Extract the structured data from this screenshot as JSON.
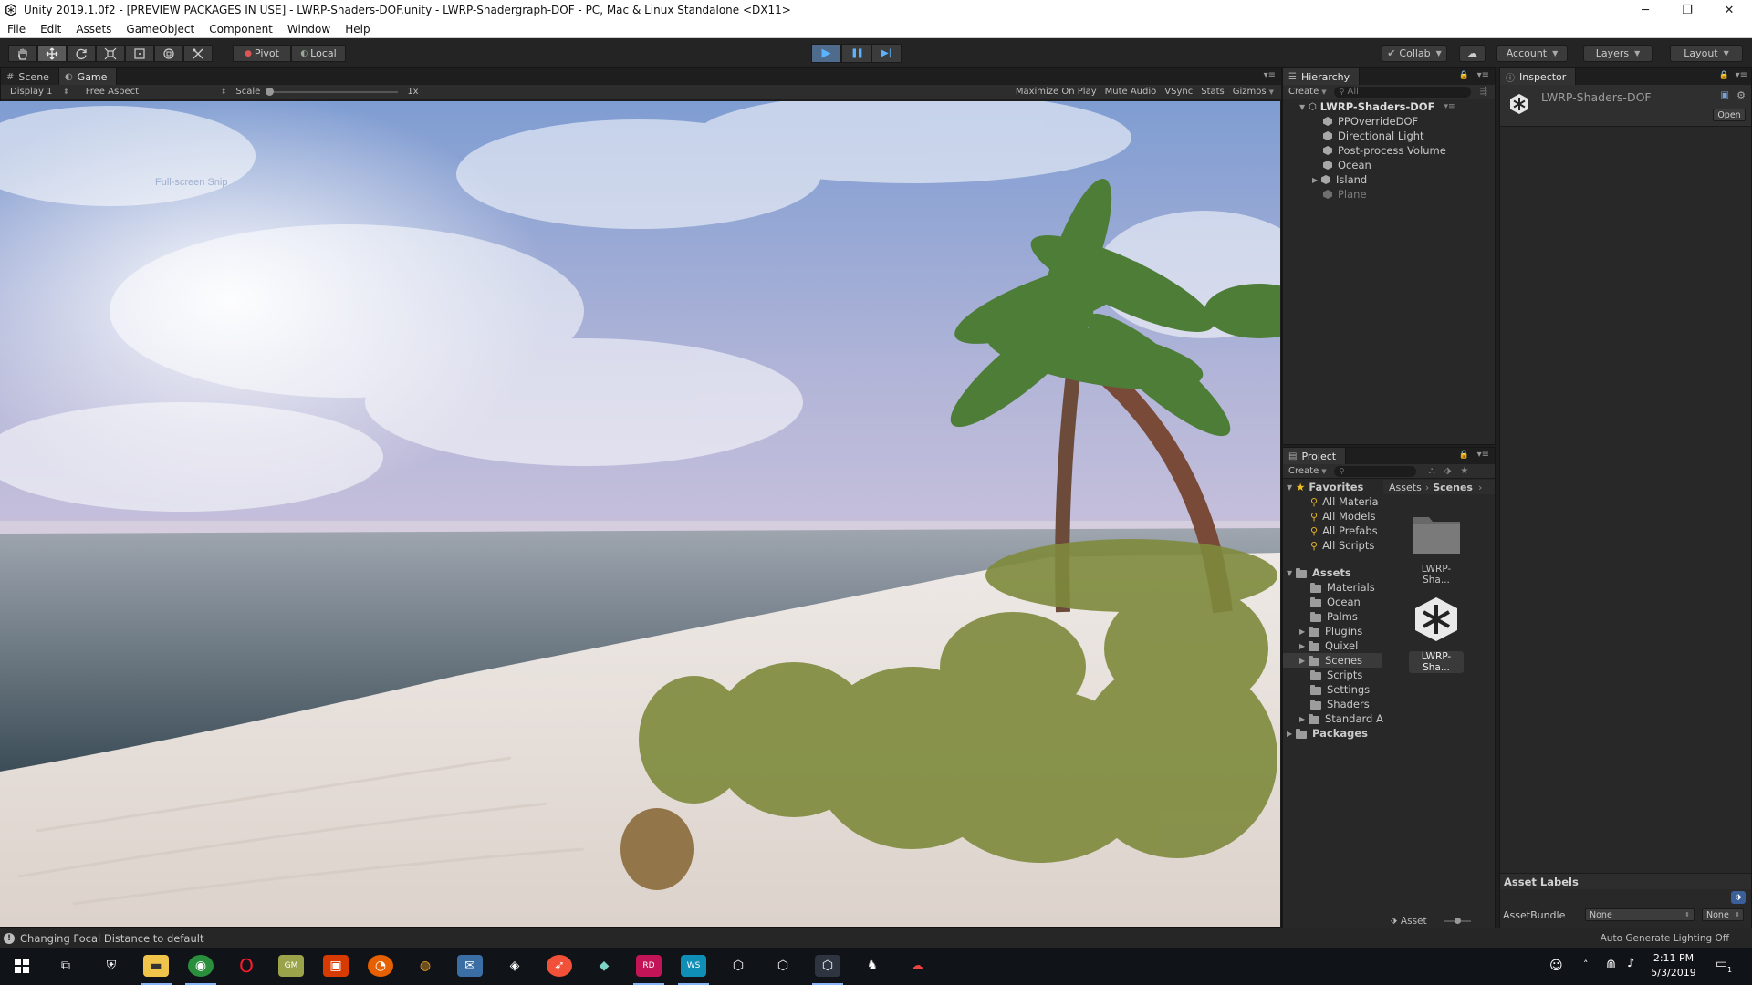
{
  "window": {
    "title": "Unity 2019.1.0f2 - [PREVIEW PACKAGES IN USE] - LWRP-Shaders-DOF.unity - LWRP-Shadergraph-DOF - PC, Mac & Linux Standalone <DX11>",
    "minimize_glyph": "─",
    "maximize_glyph": "❐",
    "close_glyph": "✕"
  },
  "menu": [
    "File",
    "Edit",
    "Assets",
    "GameObject",
    "Component",
    "Window",
    "Help"
  ],
  "toolbar": {
    "tools": [
      "hand-icon",
      "move-icon",
      "rotate-icon",
      "scale-icon",
      "rect-icon",
      "transform-icon",
      "custom-tool-icon"
    ],
    "pivot_label": "Pivot",
    "local_label": "Local",
    "play_glyph": "▶",
    "pause_glyph": "❚❚",
    "step_glyph": "▶|",
    "collab_label": "Collab",
    "account_label": "Account",
    "layers_label": "Layers",
    "layout_label": "Layout"
  },
  "scene_panel": {
    "tabs": [
      {
        "label": "Scene",
        "icon": "#"
      },
      {
        "label": "Game",
        "icon": "◐"
      }
    ],
    "display_label": "Display 1",
    "aspect_label": "Free Aspect",
    "scale_label": "Scale",
    "scale_value": "1x",
    "options": [
      "Maximize On Play",
      "Mute Audio",
      "VSync",
      "Stats",
      "Gizmos"
    ],
    "overlay_text": "Full-screen Snip"
  },
  "hierarchy": {
    "tab_label": "Hierarchy",
    "create_label": "Create",
    "search_placeholder": "All",
    "scene_name": "LWRP-Shaders-DOF",
    "items": [
      {
        "label": "PPOverrideDOF",
        "expandable": false,
        "dim": false
      },
      {
        "label": "Directional Light",
        "expandable": false,
        "dim": false
      },
      {
        "label": "Post-process Volume",
        "expandable": false,
        "dim": false
      },
      {
        "label": "Ocean",
        "expandable": false,
        "dim": false
      },
      {
        "label": "Island",
        "expandable": true,
        "dim": false
      },
      {
        "label": "Plane",
        "expandable": false,
        "dim": true
      }
    ]
  },
  "project": {
    "tab_label": "Project",
    "create_label": "Create",
    "favorites_label": "Favorites",
    "favorites": [
      "All Materia",
      "All Models",
      "All Prefabs",
      "All Scripts"
    ],
    "assets_label": "Assets",
    "asset_folders": [
      {
        "label": "Materials",
        "expandable": false
      },
      {
        "label": "Ocean",
        "expandable": false
      },
      {
        "label": "Palms",
        "expandable": false
      },
      {
        "label": "Plugins",
        "expandable": true
      },
      {
        "label": "Quixel",
        "expandable": true
      },
      {
        "label": "Scenes",
        "expandable": true
      },
      {
        "label": "Scripts",
        "expandable": false
      },
      {
        "label": "Settings",
        "expandable": false
      },
      {
        "label": "Shaders",
        "expandable": false
      },
      {
        "label": "Standard A",
        "expandable": true
      }
    ],
    "packages_label": "Packages",
    "breadcrumb": [
      "Assets",
      "Scenes"
    ],
    "grid_items": [
      "LWRP-Sha...",
      "LWRP-Sha..."
    ],
    "footer_label": "Asset"
  },
  "inspector": {
    "tab_label": "Inspector",
    "object_name": "LWRP-Shaders-DOF",
    "open_label": "Open",
    "asset_labels_title": "Asset Labels",
    "assetbundle_label": "AssetBundle",
    "bundle_value": "None",
    "variant_value": "None",
    "auto_lighting": "Auto Generate Lighting Off"
  },
  "status": {
    "message": "Changing Focal Distance to default"
  },
  "taskbar": {
    "time": "2:11 PM",
    "date": "5/3/2019",
    "notification_count": "1",
    "apps": [
      "windows-start-icon",
      "task-view-icon",
      "defender-icon",
      "file-explorer-icon",
      "chrome-icon",
      "opera-icon",
      "gamemaker-icon",
      "office-icon",
      "firefox-icon",
      "blender-icon",
      "mail-icon",
      "game-icon",
      "swift-icon",
      "gitkraken-icon",
      "rider-icon",
      "webstorm-icon",
      "unity-hub-icon",
      "unity-icon",
      "unity-editor-icon",
      "spy-icon",
      "vpn-icon"
    ]
  },
  "colors": {
    "panel_bg": "#282828",
    "toolbar_bg": "#242424",
    "selection": "#3e5f96",
    "play_active": "#4f6b8c"
  }
}
